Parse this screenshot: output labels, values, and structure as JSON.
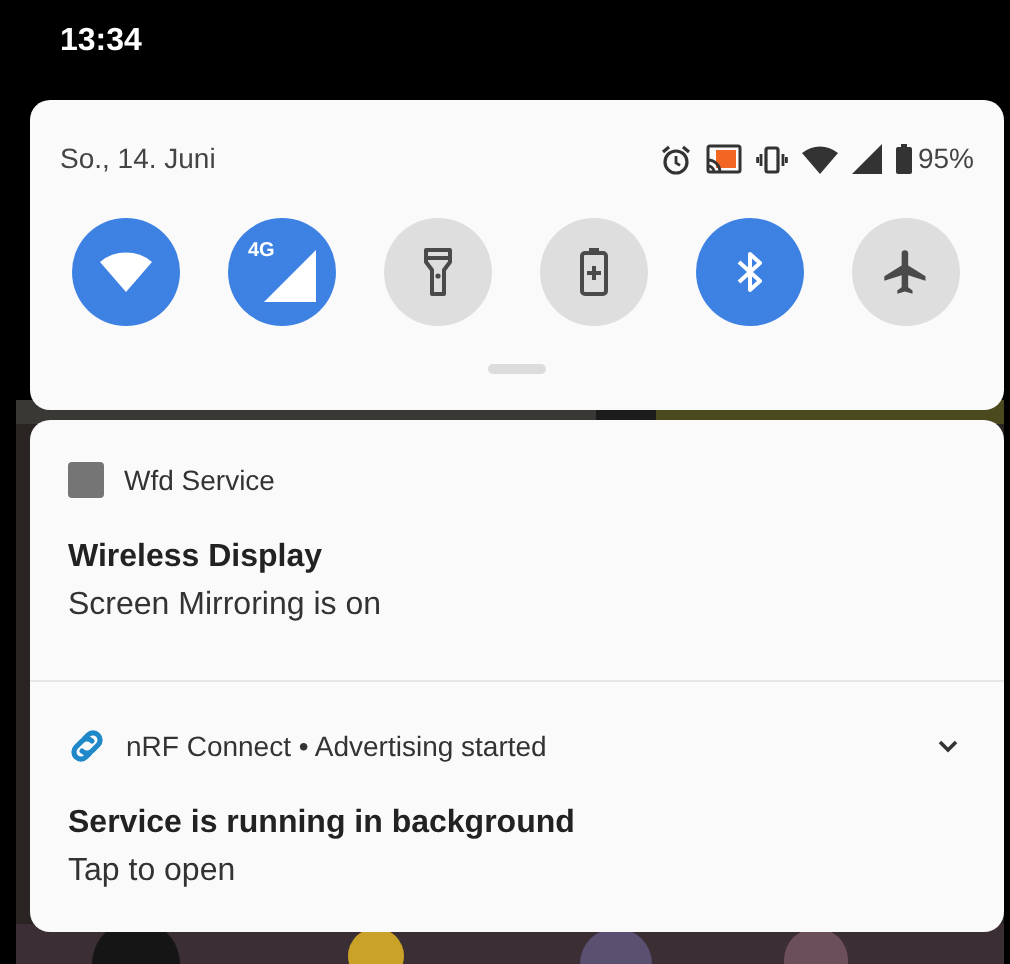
{
  "status_bar": {
    "time": "13:34"
  },
  "quick_settings": {
    "date": "So., 14. Juni",
    "battery_percent": "95%",
    "tiles": [
      {
        "kind": "wifi",
        "on": true
      },
      {
        "kind": "mobile",
        "on": true,
        "label": "4G"
      },
      {
        "kind": "flashlight",
        "on": false
      },
      {
        "kind": "battery-saver",
        "on": false
      },
      {
        "kind": "bluetooth",
        "on": true
      },
      {
        "kind": "airplane",
        "on": false
      }
    ]
  },
  "notifications": [
    {
      "app": "Wfd Service",
      "title": "Wireless Display",
      "text": "Screen Mirroring is on",
      "expandable": false
    },
    {
      "app": "nRF Connect • Advertising started",
      "title": "Service is running in background",
      "text": "Tap to open",
      "expandable": true
    }
  ]
}
